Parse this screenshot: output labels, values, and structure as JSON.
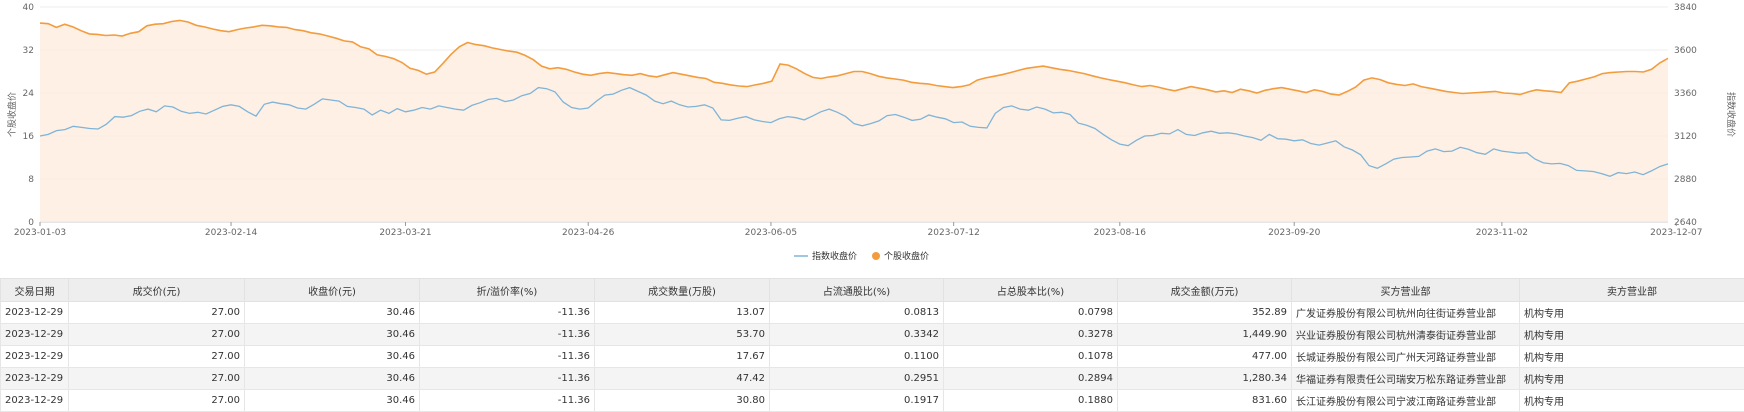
{
  "chart_data": {
    "type": "line",
    "x_ticks": [
      "2023-01-03",
      "2023-02-14",
      "2023-03-21",
      "2023-04-26",
      "2023-06-05",
      "2023-07-12",
      "2023-08-16",
      "2023-09-20",
      "2023-11-02",
      "2023-12-07"
    ],
    "ylabel_left": "个股收盘价",
    "ylabel_right": "指数收盘价",
    "ylim_left": [
      0,
      40
    ],
    "yticks_left": [
      "0",
      "8",
      "16",
      "24",
      "32",
      "40"
    ],
    "ylim_right": [
      2640,
      3840
    ],
    "yticks_right": [
      "2640",
      "2880",
      "3120",
      "3360",
      "3600",
      "3840"
    ],
    "legend_position": "bottom",
    "series": [
      {
        "name": "指数收盘价",
        "axis": "left",
        "color": "#7fb4d8",
        "values": [
          16.0,
          16.3,
          17.0,
          17.2,
          17.8,
          17.6,
          17.4,
          17.3,
          18.2,
          19.6,
          19.5,
          19.8,
          20.6,
          21.0,
          20.5,
          21.6,
          21.4,
          20.6,
          20.2,
          20.4,
          20.1,
          20.8,
          21.5,
          21.8,
          21.5,
          20.5,
          19.7,
          21.9,
          22.3,
          22.0,
          21.8,
          21.2,
          21.0,
          21.9,
          22.9,
          22.7,
          22.5,
          21.5,
          21.3,
          21.0,
          19.9,
          20.8,
          20.2,
          21.1,
          20.5,
          20.8,
          21.3,
          21.0,
          21.6,
          21.3,
          21.0,
          20.8,
          21.7,
          22.2,
          22.8,
          23.0,
          22.4,
          22.7,
          23.5,
          23.9,
          25.0,
          24.8,
          24.2,
          22.3,
          21.3,
          21.0,
          21.2,
          22.5,
          23.6,
          23.8,
          24.5,
          25.0,
          24.3,
          23.6,
          22.5,
          22.0,
          22.5,
          21.8,
          21.4,
          21.5,
          21.8,
          21.2,
          19.0,
          18.9,
          19.3,
          19.6,
          19.0,
          18.7,
          18.5,
          19.2,
          19.6,
          19.4,
          19.0,
          19.7,
          20.5,
          21.0,
          20.4,
          19.6,
          18.3,
          17.9,
          18.3,
          18.8,
          19.8,
          20.0,
          19.5,
          18.9,
          19.1,
          19.9,
          19.5,
          19.2,
          18.5,
          18.6,
          17.8,
          17.6,
          17.5,
          20.2,
          21.3,
          21.6,
          21.0,
          20.8,
          21.4,
          21.0,
          20.3,
          20.4,
          20.0,
          18.4,
          18.0,
          17.4,
          16.3,
          15.3,
          14.5,
          14.2,
          15.2,
          16.0,
          16.1,
          16.5,
          16.4,
          17.2,
          16.3,
          16.1,
          16.6,
          16.9,
          16.5,
          16.6,
          16.4,
          16.0,
          15.7,
          15.2,
          16.3,
          15.5,
          15.4,
          15.1,
          15.3,
          14.6,
          14.3,
          14.7,
          15.1,
          14.0,
          13.4,
          12.5,
          10.5,
          10.0,
          10.8,
          11.7,
          12.0,
          12.1,
          12.2,
          13.2,
          13.6,
          13.1,
          13.2,
          13.9,
          13.5,
          12.9,
          12.6,
          13.6,
          13.2,
          13.0,
          12.8,
          12.9,
          11.7,
          11.0,
          10.8,
          10.9,
          10.5,
          9.6,
          9.5,
          9.4,
          9.0,
          8.5,
          9.2,
          9.0,
          9.3,
          8.8,
          9.5,
          10.3,
          10.8
        ]
      },
      {
        "name": "个股收盘价",
        "axis": "left",
        "color": "#f39c3d",
        "values": [
          37.0,
          36.9,
          36.2,
          36.8,
          36.3,
          35.6,
          35.0,
          34.9,
          34.7,
          34.8,
          34.6,
          35.1,
          35.4,
          36.5,
          36.8,
          36.9,
          37.3,
          37.5,
          37.2,
          36.6,
          36.3,
          35.9,
          35.6,
          35.4,
          35.8,
          36.1,
          36.3,
          36.6,
          36.5,
          36.3,
          36.2,
          35.8,
          35.6,
          35.2,
          35.0,
          34.6,
          34.2,
          33.7,
          33.5,
          32.6,
          32.2,
          31.1,
          30.8,
          30.4,
          29.7,
          28.6,
          28.2,
          27.5,
          27.9,
          29.5,
          31.2,
          32.6,
          33.4,
          33.0,
          32.8,
          32.4,
          32.1,
          31.8,
          31.6,
          31.0,
          30.2,
          29.0,
          28.5,
          28.7,
          28.4,
          27.9,
          27.5,
          27.3,
          27.6,
          27.8,
          27.6,
          27.4,
          27.3,
          27.6,
          27.2,
          27.0,
          27.4,
          27.8,
          27.5,
          27.2,
          26.9,
          26.7,
          26.0,
          25.8,
          25.5,
          25.3,
          25.2,
          25.5,
          25.8,
          26.2,
          29.4,
          29.2,
          28.5,
          27.6,
          26.9,
          26.7,
          27.0,
          27.2,
          27.6,
          28.0,
          28.0,
          27.6,
          27.1,
          26.8,
          26.6,
          26.4,
          26.0,
          25.8,
          25.7,
          25.4,
          25.2,
          25.0,
          25.2,
          25.5,
          26.4,
          26.8,
          27.1,
          27.4,
          27.8,
          28.2,
          28.6,
          28.8,
          29.0,
          28.7,
          28.4,
          28.2,
          27.9,
          27.6,
          27.2,
          26.8,
          26.5,
          26.2,
          25.9,
          25.5,
          25.2,
          25.4,
          25.1,
          24.7,
          24.4,
          24.8,
          25.2,
          24.9,
          24.6,
          24.2,
          24.4,
          24.1,
          24.7,
          24.4,
          24.0,
          24.5,
          24.8,
          25.0,
          24.7,
          24.4,
          24.1,
          24.6,
          24.3,
          23.8,
          23.6,
          24.3,
          25.1,
          26.4,
          26.8,
          26.5,
          25.9,
          25.6,
          25.4,
          25.7,
          25.2,
          24.9,
          24.6,
          24.3,
          24.1,
          23.9,
          24.0,
          24.1,
          24.2,
          24.3,
          24.0,
          23.9,
          23.7,
          24.2,
          24.6,
          24.4,
          24.3,
          24.1,
          25.9,
          26.2,
          26.6,
          27.0,
          27.6,
          27.8,
          27.9,
          28.0,
          28.0,
          27.9,
          28.4,
          29.6,
          30.46
        ]
      }
    ]
  },
  "table": {
    "headers": [
      "交易日期",
      "成交价(元)",
      "收盘价(元)",
      "折/溢价率(%)",
      "成交数量(万股)",
      "占流通股比(%)",
      "占总股本比(%)",
      "成交金额(万元)",
      "买方营业部",
      "卖方营业部"
    ],
    "rows": [
      [
        "2023-12-29",
        "27.00",
        "30.46",
        "-11.36",
        "13.07",
        "0.0813",
        "0.0798",
        "352.89",
        "广发证券股份有限公司杭州向往街证券营业部",
        "机构专用"
      ],
      [
        "2023-12-29",
        "27.00",
        "30.46",
        "-11.36",
        "53.70",
        "0.3342",
        "0.3278",
        "1,449.90",
        "兴业证券股份有限公司杭州清泰街证券营业部",
        "机构专用"
      ],
      [
        "2023-12-29",
        "27.00",
        "30.46",
        "-11.36",
        "17.67",
        "0.1100",
        "0.1078",
        "477.00",
        "长城证券股份有限公司广州天河路证券营业部",
        "机构专用"
      ],
      [
        "2023-12-29",
        "27.00",
        "30.46",
        "-11.36",
        "47.42",
        "0.2951",
        "0.2894",
        "1,280.34",
        "华福证券有限责任公司瑞安万松东路证券营业部",
        "机构专用"
      ],
      [
        "2023-12-29",
        "27.00",
        "30.46",
        "-11.36",
        "30.80",
        "0.1917",
        "0.1880",
        "831.60",
        "长江证券股份有限公司宁波江南路证券营业部",
        "机构专用"
      ]
    ]
  }
}
